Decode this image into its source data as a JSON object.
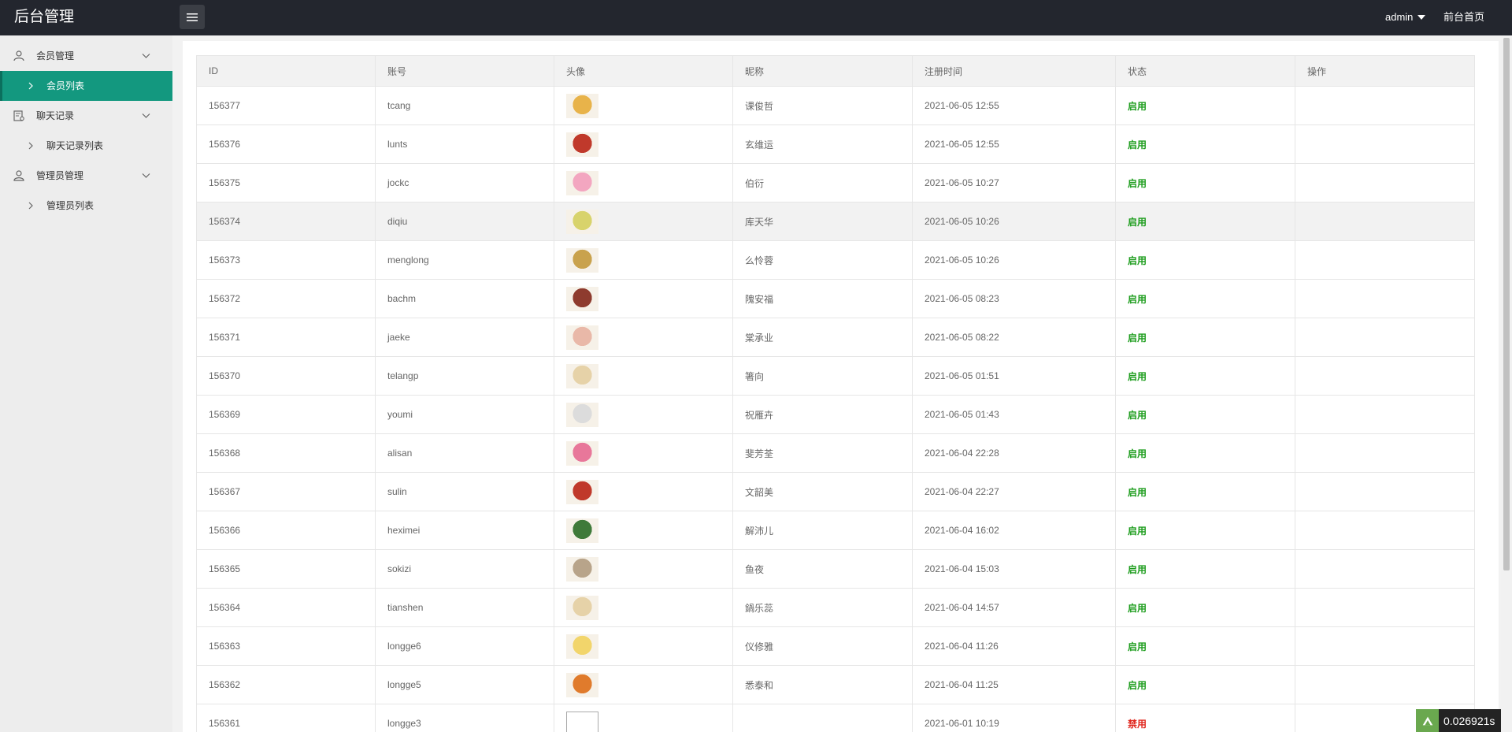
{
  "header": {
    "title": "后台管理",
    "menu_toggle_icon": "list-icon",
    "user": "admin",
    "front_link": "前台首页"
  },
  "sidebar": {
    "groups": [
      {
        "label": "会员管理",
        "icon": "user-icon",
        "items": [
          {
            "label": "会员列表",
            "active": true
          }
        ]
      },
      {
        "label": "聊天记录",
        "icon": "chat-record-icon",
        "items": [
          {
            "label": "聊天记录列表",
            "active": false
          }
        ]
      },
      {
        "label": "管理员管理",
        "icon": "admin-icon",
        "items": [
          {
            "label": "管理员列表",
            "active": false
          }
        ]
      }
    ]
  },
  "table": {
    "columns": [
      "ID",
      "账号",
      "头像",
      "昵称",
      "注册时间",
      "状态",
      "操作"
    ],
    "rows": [
      {
        "id": "156377",
        "account": "tcang",
        "nickname": "课俊哲",
        "reg_time": "2021-06-05 12:55",
        "status": "启用",
        "avatar_color": "#e8b34a"
      },
      {
        "id": "156376",
        "account": "lunts",
        "nickname": "玄维运",
        "reg_time": "2021-06-05 12:55",
        "status": "启用",
        "avatar_color": "#c0392b"
      },
      {
        "id": "156375",
        "account": "jockc",
        "nickname": "伯衍",
        "reg_time": "2021-06-05 10:27",
        "status": "启用",
        "avatar_color": "#f3a6c0"
      },
      {
        "id": "156374",
        "account": "diqiu",
        "nickname": "库天华",
        "reg_time": "2021-06-05 10:26",
        "status": "启用",
        "avatar_color": "#d8d36b"
      },
      {
        "id": "156373",
        "account": "menglong",
        "nickname": "么怜蓉",
        "reg_time": "2021-06-05 10:26",
        "status": "启用",
        "avatar_color": "#c9a24d"
      },
      {
        "id": "156372",
        "account": "bachm",
        "nickname": "隗安福",
        "reg_time": "2021-06-05 08:23",
        "status": "启用",
        "avatar_color": "#8e3b2e"
      },
      {
        "id": "156371",
        "account": "jaeke",
        "nickname": "棠承业",
        "reg_time": "2021-06-05 08:22",
        "status": "启用",
        "avatar_color": "#e9b8a8"
      },
      {
        "id": "156370",
        "account": "telangp",
        "nickname": "箸向",
        "reg_time": "2021-06-05 01:51",
        "status": "启用",
        "avatar_color": "#e6d2a8"
      },
      {
        "id": "156369",
        "account": "youmi",
        "nickname": "祝雁卉",
        "reg_time": "2021-06-05 01:43",
        "status": "启用",
        "avatar_color": "#dcdcdc"
      },
      {
        "id": "156368",
        "account": "alisan",
        "nickname": "斐芳荃",
        "reg_time": "2021-06-04 22:28",
        "status": "启用",
        "avatar_color": "#e8779a"
      },
      {
        "id": "156367",
        "account": "sulin",
        "nickname": "文韶美",
        "reg_time": "2021-06-04 22:27",
        "status": "启用",
        "avatar_color": "#c0392b"
      },
      {
        "id": "156366",
        "account": "heximei",
        "nickname": "解沛儿",
        "reg_time": "2021-06-04 16:02",
        "status": "启用",
        "avatar_color": "#3f7a3a"
      },
      {
        "id": "156365",
        "account": "sokizi",
        "nickname": "鱼夜",
        "reg_time": "2021-06-04 15:03",
        "status": "启用",
        "avatar_color": "#b8a48a"
      },
      {
        "id": "156364",
        "account": "tianshen",
        "nickname": "鍋乐蕊",
        "reg_time": "2021-06-04 14:57",
        "status": "启用",
        "avatar_color": "#e6d2a8"
      },
      {
        "id": "156363",
        "account": "longge6",
        "nickname": "仪修雅",
        "reg_time": "2021-06-04 11:26",
        "status": "启用",
        "avatar_color": "#f2d56b"
      },
      {
        "id": "156362",
        "account": "longge5",
        "nickname": "悉泰和",
        "reg_time": "2021-06-04 11:25",
        "status": "启用",
        "avatar_color": "#e07b2c"
      },
      {
        "id": "156361",
        "account": "longge3",
        "nickname": "",
        "reg_time": "2021-06-01 10:19",
        "status": "禁用",
        "avatar_color": "#ffffff"
      }
    ]
  },
  "timer": {
    "value": "0.026921s"
  },
  "colors": {
    "accent": "#13987f",
    "header_bg": "#23262e",
    "status_on": "#1d9d1d",
    "status_off": "#e0281f"
  }
}
